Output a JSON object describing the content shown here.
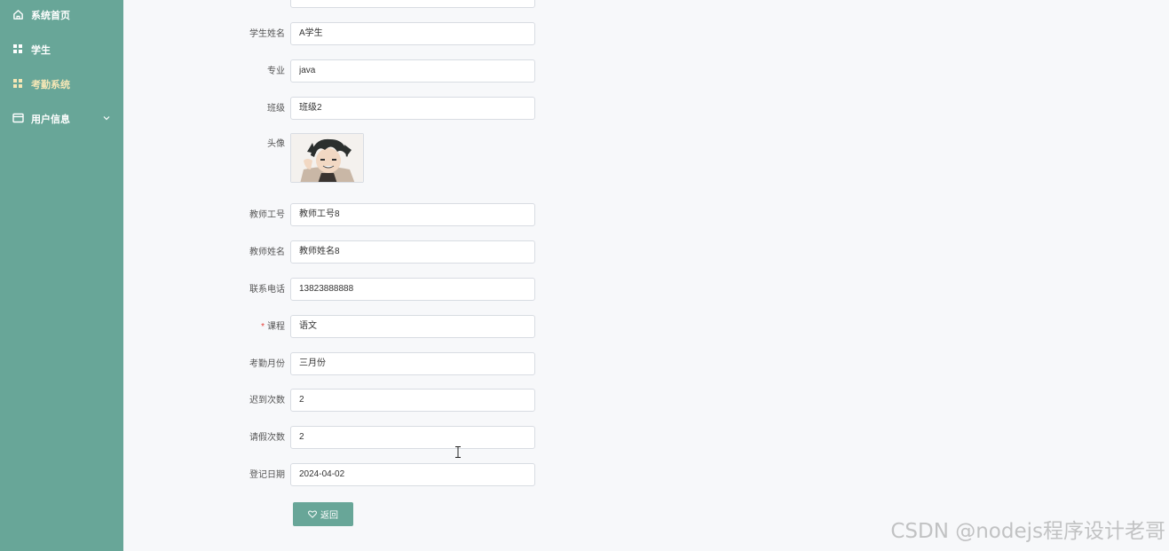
{
  "sidebar": {
    "items": [
      {
        "label": "系统首页",
        "icon": "home-icon"
      },
      {
        "label": "学生",
        "icon": "grid-icon"
      },
      {
        "label": "考勤系统",
        "icon": "grid-icon",
        "active": true
      },
      {
        "label": "用户信息",
        "icon": "card-icon",
        "has_submenu": true
      }
    ],
    "bg_color": "#68a698",
    "active_color": "#f6e7b6"
  },
  "form": {
    "student_name": {
      "label": "学生姓名",
      "value": "A学生"
    },
    "major": {
      "label": "专业",
      "value": "java"
    },
    "class_name": {
      "label": "班级",
      "value": "班级2"
    },
    "avatar": {
      "label": "头像"
    },
    "teacher_id": {
      "label": "教师工号",
      "value": "教师工号8"
    },
    "teacher_name": {
      "label": "教师姓名",
      "value": "教师姓名8"
    },
    "phone": {
      "label": "联系电话",
      "value": "13823888888"
    },
    "course": {
      "label": "课程",
      "value": "语文",
      "required_mark": "*"
    },
    "attendance_month": {
      "label": "考勤月份",
      "value": "三月份"
    },
    "late_count": {
      "label": "迟到次数",
      "value": "2"
    },
    "leave_count": {
      "label": "请假次数",
      "value": "2"
    },
    "register_date": {
      "label": "登记日期",
      "value": "2024-04-02"
    }
  },
  "buttons": {
    "back_label": "返回"
  },
  "watermark": "CSDN @nodejs程序设计老哥"
}
